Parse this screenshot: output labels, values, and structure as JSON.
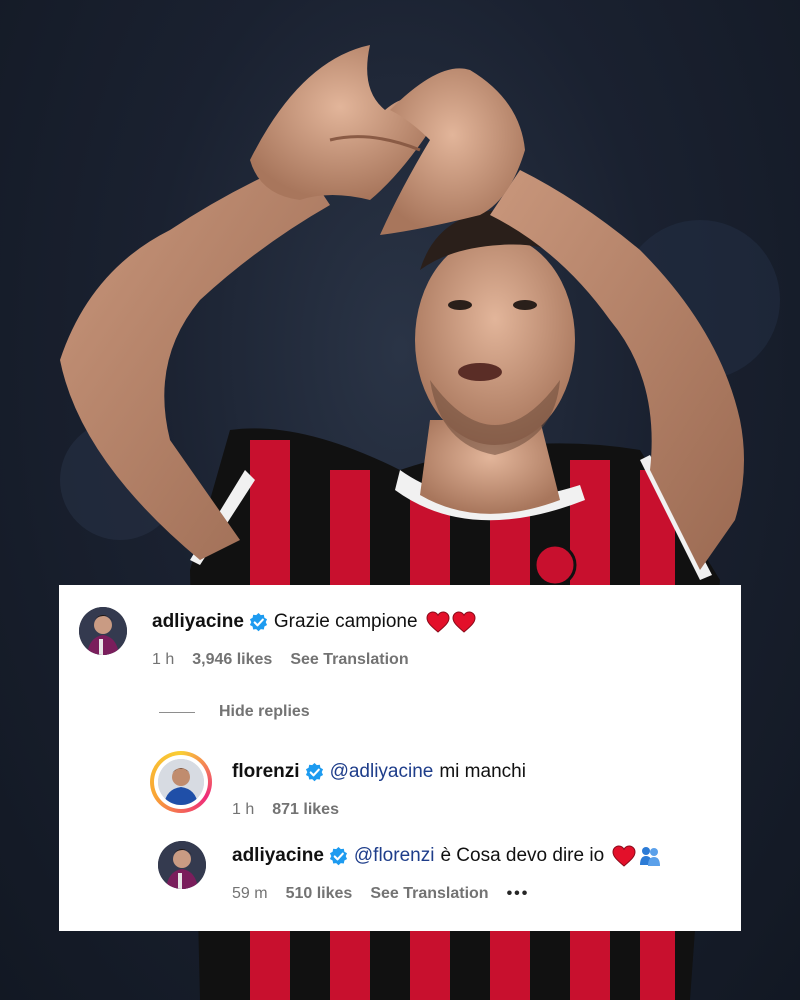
{
  "comments": {
    "first": {
      "username": "adliyacine",
      "text": "Grazie campione",
      "time": "1 h",
      "likes": "3,946 likes",
      "translate": "See Translation"
    },
    "hide_replies": "Hide replies",
    "reply1": {
      "username": "florenzi",
      "mention": "@adliyacine",
      "text": "mi manchi",
      "time": "1 h",
      "likes": "871 likes"
    },
    "reply2": {
      "username": "adliyacine",
      "mention": "@florenzi",
      "text": "è Cosa devo dire io",
      "time": "59 m",
      "likes": "510 likes",
      "translate": "See Translation",
      "more": "•••"
    }
  },
  "colors": {
    "verified": "#1d9bf0",
    "heart": "#e3102a",
    "mention": "#1e3d8a",
    "jersey_red": "#c8102e",
    "jersey_black": "#111111"
  },
  "icons": [
    "verified-badge-icon",
    "heart-emoji-icon",
    "hug-emoji-icon",
    "more-options-icon"
  ]
}
